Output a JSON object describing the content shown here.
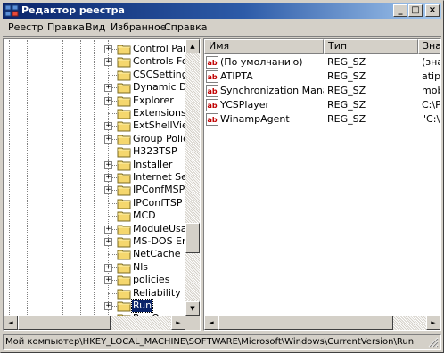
{
  "window": {
    "title": "Редактор реестра",
    "minimize": "_",
    "maximize": "□",
    "close": "×"
  },
  "menu": [
    {
      "label": "Реестр"
    },
    {
      "label": "Правка"
    },
    {
      "label": "Вид"
    },
    {
      "label": "Избранное"
    },
    {
      "label": "Справка"
    }
  ],
  "tree": {
    "items": [
      {
        "label": "Control Panel",
        "expander": "+"
      },
      {
        "label": "Controls Folde",
        "expander": "+"
      },
      {
        "label": "CSCSettings",
        "expander": ""
      },
      {
        "label": "Dynamic Direct",
        "expander": "+"
      },
      {
        "label": "Explorer",
        "expander": "+"
      },
      {
        "label": "Extensions",
        "expander": ""
      },
      {
        "label": "ExtShellViews",
        "expander": "+"
      },
      {
        "label": "Group Policy",
        "expander": "+"
      },
      {
        "label": "H323TSP",
        "expander": ""
      },
      {
        "label": "Installer",
        "expander": "+"
      },
      {
        "label": "Internet Settin",
        "expander": "+"
      },
      {
        "label": "IPConfMSP",
        "expander": "+"
      },
      {
        "label": "IPConfTSP",
        "expander": ""
      },
      {
        "label": "MCD",
        "expander": ""
      },
      {
        "label": "ModuleUsage",
        "expander": "+"
      },
      {
        "label": "MS-DOS Emula",
        "expander": "+"
      },
      {
        "label": "NetCache",
        "expander": ""
      },
      {
        "label": "Nls",
        "expander": "+"
      },
      {
        "label": "policies",
        "expander": "+"
      },
      {
        "label": "Reliability",
        "expander": ""
      },
      {
        "label": "Run",
        "expander": "+",
        "selected": true
      },
      {
        "label": "RunOnce",
        "expander": ""
      }
    ],
    "scroll_up": "▲",
    "scroll_down": "▼",
    "scroll_left": "◄",
    "scroll_right": "►"
  },
  "list": {
    "columns": [
      "Имя",
      "Тип",
      "Знач"
    ],
    "rows": [
      {
        "name": "(По умолчанию)",
        "type": "REG_SZ",
        "data": "(знач"
      },
      {
        "name": "ATIPTA",
        "type": "REG_SZ",
        "data": "atipt"
      },
      {
        "name": "Synchronization Manager",
        "type": "REG_SZ",
        "data": "mobs"
      },
      {
        "name": "YCSPlayer",
        "type": "REG_SZ",
        "data": "C:\\Pr"
      },
      {
        "name": "WinampAgent",
        "type": "REG_SZ",
        "data": "\"C:\\P"
      }
    ],
    "scroll_left": "◄",
    "scroll_right": "►"
  },
  "statusbar": {
    "path": "Мой компьютер\\HKEY_LOCAL_MACHINE\\SOFTWARE\\Microsoft\\Windows\\CurrentVersion\\Run"
  },
  "colors": {
    "title_active": "#0a246a",
    "selection": "#0a246a",
    "folder": "#f5d76e",
    "face": "#d4d0c8"
  }
}
